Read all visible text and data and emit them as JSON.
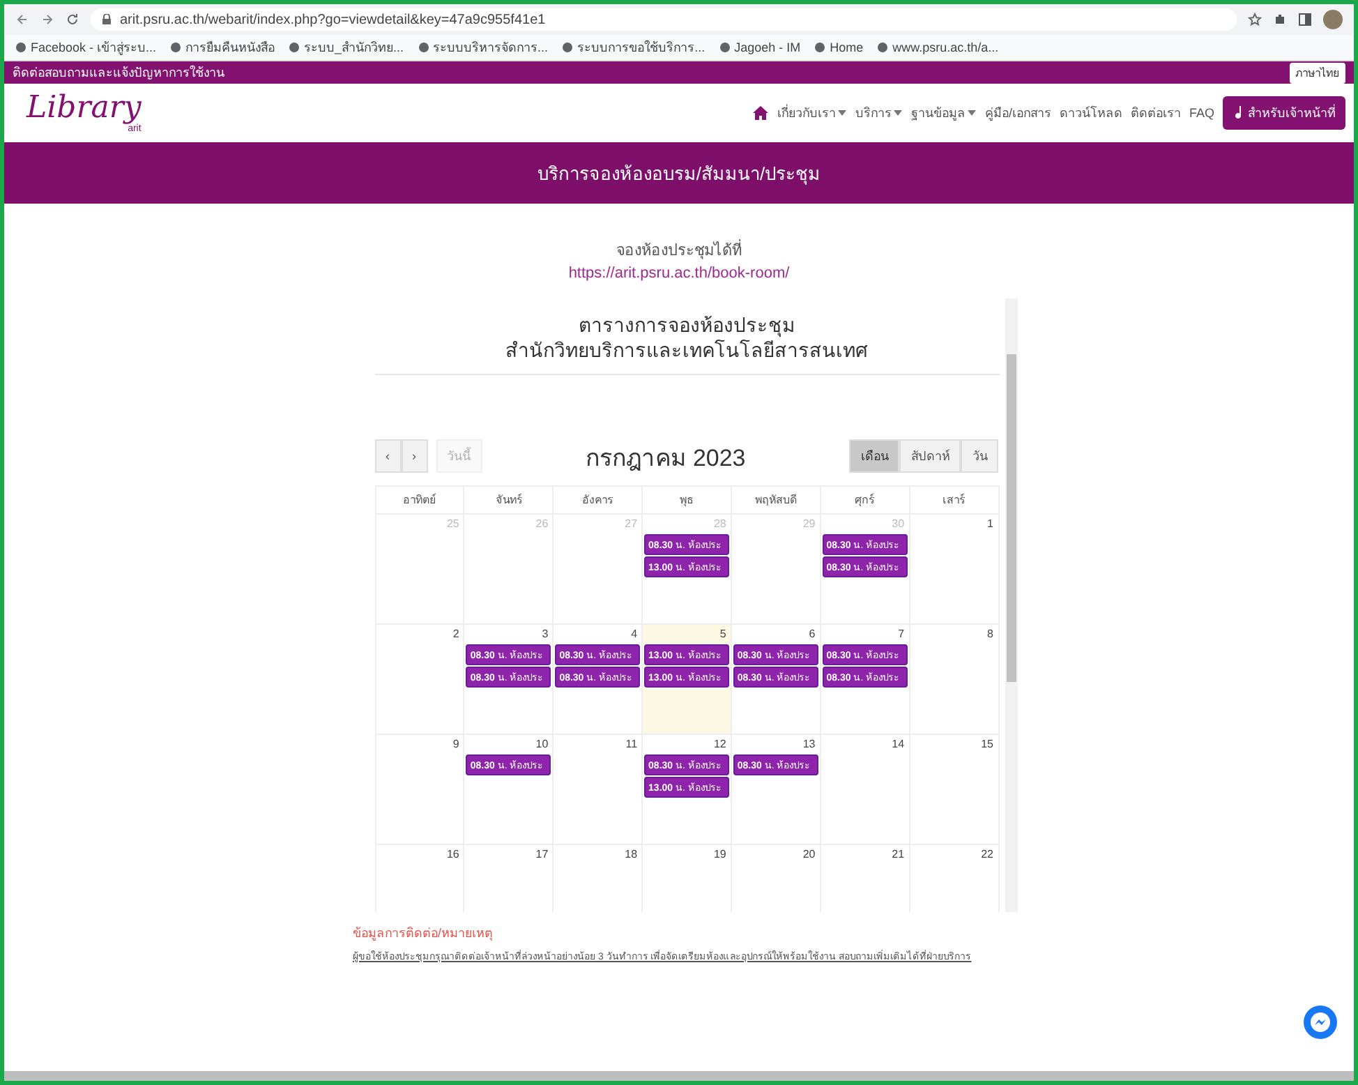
{
  "browser": {
    "url": "arit.psru.ac.th/webarit/index.php?go=viewdetail&key=47a9c955f41e1",
    "bookmarks": [
      {
        "label": "Facebook - เข้าสู่ระบ..."
      },
      {
        "label": "การยืมคืนหนังสือ"
      },
      {
        "label": "ระบบ_สำนักวิทย..."
      },
      {
        "label": "ระบบบริหารจัดการ..."
      },
      {
        "label": "ระบบการขอใช้บริการ..."
      },
      {
        "label": "Jagoeh - IM"
      },
      {
        "label": "Home"
      },
      {
        "label": "www.psru.ac.th/a..."
      }
    ]
  },
  "topbar": {
    "contact": "ติดต่อสอบถามและแจ้งปัญหาการใช้งาน",
    "language": "ภาษาไทย"
  },
  "header": {
    "logo": "Library",
    "logo_sub": "arit",
    "nav": [
      {
        "label": "เกี่ยวกับเรา",
        "dropdown": true
      },
      {
        "label": "บริการ",
        "dropdown": true
      },
      {
        "label": "ฐานข้อมูล",
        "dropdown": true
      },
      {
        "label": "คู่มือ/เอกสาร",
        "dropdown": false
      },
      {
        "label": "ดาวน์โหลด",
        "dropdown": false
      },
      {
        "label": "ติดต่อเรา",
        "dropdown": false
      },
      {
        "label": "FAQ",
        "dropdown": false
      }
    ],
    "staff_button": "สำหรับเจ้าหน้าที่"
  },
  "banner": {
    "title": "บริการจองห้องอบรม/สัมมนา/ประชุม"
  },
  "booking": {
    "intro": "จองห้องประชุมได้ที่",
    "link": "https://arit.psru.ac.th/book-room/"
  },
  "calendar": {
    "title_lines": [
      "ตารางการจองห้องประชุม",
      "สำนักวิทยบริการและเทคโนโลยีสารสนเทศ"
    ],
    "prev": "‹",
    "next": "›",
    "today_button": {
      "label": "วันนี้",
      "disabled": true
    },
    "month": "กรกฎาคม 2023",
    "views": [
      {
        "label": "เดือน",
        "selected": true
      },
      {
        "label": "สัปดาห์",
        "selected": false
      },
      {
        "label": "วัน",
        "selected": false
      }
    ],
    "weekdays": [
      "อาทิตย์",
      "จันทร์",
      "อังคาร",
      "พุธ",
      "พฤหัสบดี",
      "ศุกร์",
      "เสาร์"
    ],
    "weeks": [
      {
        "days": [
          {
            "date": "25",
            "other_month": true,
            "today": false
          },
          {
            "date": "26",
            "other_month": true,
            "today": false
          },
          {
            "date": "27",
            "other_month": true,
            "today": false
          },
          {
            "date": "28",
            "other_month": true,
            "today": false,
            "events": [
              {
                "time": "08.30",
                "title": "น. ห้องประ"
              },
              {
                "time": "13.00",
                "title": "น. ห้องประ"
              }
            ]
          },
          {
            "date": "29",
            "other_month": true,
            "today": false
          },
          {
            "date": "30",
            "other_month": true,
            "today": false,
            "events": [
              {
                "time": "08.30",
                "title": "น. ห้องประ"
              },
              {
                "time": "08.30",
                "title": "น. ห้องประ"
              }
            ]
          },
          {
            "date": "1",
            "other_month": false,
            "today": false
          }
        ]
      },
      {
        "days": [
          {
            "date": "2",
            "other_month": false,
            "today": false
          },
          {
            "date": "3",
            "other_month": false,
            "today": false,
            "events": [
              {
                "time": "08.30",
                "title": "น. ห้องประ"
              },
              {
                "time": "08.30",
                "title": "น. ห้องประ"
              }
            ]
          },
          {
            "date": "4",
            "other_month": false,
            "today": false,
            "events": [
              {
                "time": "08.30",
                "title": "น. ห้องประ"
              },
              {
                "time": "08.30",
                "title": "น. ห้องประ"
              }
            ]
          },
          {
            "date": "5",
            "other_month": false,
            "today": true,
            "events": [
              {
                "time": "13.00",
                "title": "น. ห้องประ"
              },
              {
                "time": "13.00",
                "title": "น. ห้องประ"
              }
            ]
          },
          {
            "date": "6",
            "other_month": false,
            "today": false,
            "events": [
              {
                "time": "08.30",
                "title": "น. ห้องประ"
              },
              {
                "time": "08.30",
                "title": "น. ห้องประ"
              }
            ]
          },
          {
            "date": "7",
            "other_month": false,
            "today": false,
            "events": [
              {
                "time": "08.30",
                "title": "น. ห้องประ"
              },
              {
                "time": "08.30",
                "title": "น. ห้องประ"
              }
            ]
          },
          {
            "date": "8",
            "other_month": false,
            "today": false
          }
        ]
      },
      {
        "days": [
          {
            "date": "9",
            "other_month": false,
            "today": false
          },
          {
            "date": "10",
            "other_month": false,
            "today": false,
            "events": [
              {
                "time": "08.30",
                "title": "น. ห้องประ"
              }
            ]
          },
          {
            "date": "11",
            "other_month": false,
            "today": false
          },
          {
            "date": "12",
            "other_month": false,
            "today": false,
            "events": [
              {
                "time": "08.30",
                "title": "น. ห้องประ"
              },
              {
                "time": "13.00",
                "title": "น. ห้องประ"
              }
            ]
          },
          {
            "date": "13",
            "other_month": false,
            "today": false,
            "events": [
              {
                "time": "08.30",
                "title": "น. ห้องประ"
              }
            ]
          },
          {
            "date": "14",
            "other_month": false,
            "today": false
          },
          {
            "date": "15",
            "other_month": false,
            "today": false
          }
        ]
      },
      {
        "days": [
          {
            "date": "16",
            "other_month": false,
            "today": false
          },
          {
            "date": "17",
            "other_month": false,
            "today": false
          },
          {
            "date": "18",
            "other_month": false,
            "today": false
          },
          {
            "date": "19",
            "other_month": false,
            "today": false
          },
          {
            "date": "20",
            "other_month": false,
            "today": false
          },
          {
            "date": "21",
            "other_month": false,
            "today": false
          },
          {
            "date": "22",
            "other_month": false,
            "today": false
          }
        ]
      }
    ]
  },
  "notes": {
    "heading": "ข้อมูลการติดต่อ/หมายเหตุ",
    "text": "ผู้ขอใช้ห้องประชุมกรุณาติดต่อเจ้าหน้าที่ล่วงหน้าอย่างน้อย 3 วันทำการ เพื่อจัดเตรียมห้องและอุปกรณ์ให้พร้อมใช้งาน สอบถามเพิ่มเติมได้ที่ฝ่ายบริการ"
  }
}
